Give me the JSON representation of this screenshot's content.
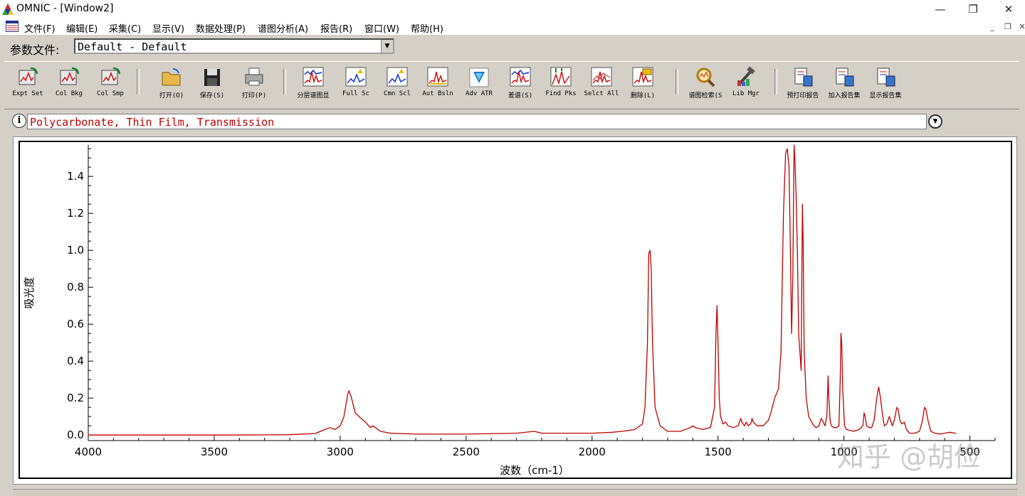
{
  "window": {
    "title": "OMNIC - [Window2]",
    "minimize_glyph": "—",
    "restore_glyph": "❐",
    "close_glyph": "✕"
  },
  "menu": {
    "items": [
      "文件(F)",
      "编辑(E)",
      "采集(C)",
      "显示(V)",
      "数据处理(P)",
      "谱图分析(A)",
      "报告(R)",
      "窗口(W)",
      "帮助(H)"
    ]
  },
  "params": {
    "label": "参数文件:",
    "value": "Default - Default"
  },
  "toolbar": {
    "groups": [
      [
        {
          "label": "Expt Set",
          "icon": "expt-set-icon"
        },
        {
          "label": "Col Bkg",
          "icon": "collect-background-icon"
        },
        {
          "label": "Col Smp",
          "icon": "collect-sample-icon"
        }
      ],
      [
        {
          "label": "打开(O)",
          "icon": "open-folder-icon"
        },
        {
          "label": "保存(S)",
          "icon": "save-disk-icon"
        },
        {
          "label": "打印(P)",
          "icon": "printer-icon"
        }
      ],
      [
        {
          "label": "分层谱图显",
          "icon": "stack-spectra-icon"
        },
        {
          "label": "Full Sc",
          "icon": "full-scale-icon"
        },
        {
          "label": "Cmn Scl",
          "icon": "common-scale-icon"
        },
        {
          "label": "Aut Bsln",
          "icon": "auto-baseline-icon"
        },
        {
          "label": "Adv ATR",
          "icon": "advanced-atr-icon"
        },
        {
          "label": "差谱(S)",
          "icon": "subtract-icon"
        },
        {
          "label": "Find Pks",
          "icon": "find-peaks-icon"
        },
        {
          "label": "Selct All",
          "icon": "select-all-icon"
        },
        {
          "label": "删除(L)",
          "icon": "delete-icon"
        }
      ],
      [
        {
          "label": "谱图检索(S",
          "icon": "search-magnifier-icon"
        },
        {
          "label": "Lib Mgr",
          "icon": "library-manager-icon"
        }
      ],
      [
        {
          "label": "预打印报告",
          "icon": "print-preview-icon"
        },
        {
          "label": "加入报告集",
          "icon": "add-to-report-icon"
        },
        {
          "label": "显示报告集",
          "icon": "show-report-icon"
        }
      ]
    ]
  },
  "spectrum_title": "Polycarbonate, Thin Film, Transmission",
  "watermark": "知乎 @胡俭",
  "colors": {
    "trace": "#c00000",
    "title_text": "#c00000",
    "chrome": "#d4d0c8"
  },
  "chart_data": {
    "type": "line",
    "xlabel": "波数（cm-1）",
    "ylabel": "吸光度",
    "xlim": [
      4000,
      400
    ],
    "ylim": [
      -0.03,
      1.57
    ],
    "x_reversed": true,
    "xticks": [
      4000,
      3500,
      3000,
      2500,
      2000,
      1500,
      1000,
      500
    ],
    "xtick_labels": [
      "4000",
      "3500",
      "3000",
      "2500",
      "2000",
      "1500",
      "1000",
      "500"
    ],
    "yticks": [
      0.0,
      0.2,
      0.4,
      0.6,
      0.8,
      1.0,
      1.2,
      1.4
    ],
    "ytick_labels": [
      "0.0",
      "0.2",
      "0.4",
      "0.6",
      "0.8",
      "1.0",
      "1.2",
      "1.4"
    ],
    "grid": false,
    "series": [
      {
        "color": "#c00000",
        "points": [
          [
            4000,
            0.0
          ],
          [
            3800,
            0.0
          ],
          [
            3600,
            0.0
          ],
          [
            3400,
            0.0
          ],
          [
            3200,
            0.002
          ],
          [
            3100,
            0.008
          ],
          [
            3060,
            0.03
          ],
          [
            3040,
            0.04
          ],
          [
            3020,
            0.03
          ],
          [
            3000,
            0.05
          ],
          [
            2985,
            0.1
          ],
          [
            2970,
            0.22
          ],
          [
            2965,
            0.24
          ],
          [
            2955,
            0.2
          ],
          [
            2940,
            0.12
          ],
          [
            2925,
            0.1
          ],
          [
            2900,
            0.07
          ],
          [
            2880,
            0.04
          ],
          [
            2870,
            0.05
          ],
          [
            2860,
            0.04
          ],
          [
            2840,
            0.02
          ],
          [
            2800,
            0.01
          ],
          [
            2700,
            0.005
          ],
          [
            2500,
            0.005
          ],
          [
            2300,
            0.01
          ],
          [
            2230,
            0.02
          ],
          [
            2200,
            0.01
          ],
          [
            2000,
            0.01
          ],
          [
            1920,
            0.015
          ],
          [
            1880,
            0.02
          ],
          [
            1830,
            0.03
          ],
          [
            1800,
            0.06
          ],
          [
            1790,
            0.15
          ],
          [
            1780,
            0.5
          ],
          [
            1775,
            0.98
          ],
          [
            1770,
            1.0
          ],
          [
            1765,
            0.9
          ],
          [
            1760,
            0.5
          ],
          [
            1750,
            0.15
          ],
          [
            1730,
            0.05
          ],
          [
            1700,
            0.02
          ],
          [
            1650,
            0.02
          ],
          [
            1610,
            0.04
          ],
          [
            1600,
            0.05
          ],
          [
            1590,
            0.04
          ],
          [
            1560,
            0.03
          ],
          [
            1530,
            0.04
          ],
          [
            1514,
            0.15
          ],
          [
            1508,
            0.55
          ],
          [
            1504,
            0.7
          ],
          [
            1500,
            0.5
          ],
          [
            1495,
            0.2
          ],
          [
            1490,
            0.1
          ],
          [
            1480,
            0.06
          ],
          [
            1470,
            0.07
          ],
          [
            1460,
            0.05
          ],
          [
            1440,
            0.04
          ],
          [
            1420,
            0.05
          ],
          [
            1410,
            0.09
          ],
          [
            1405,
            0.07
          ],
          [
            1395,
            0.05
          ],
          [
            1388,
            0.07
          ],
          [
            1380,
            0.05
          ],
          [
            1370,
            0.06
          ],
          [
            1365,
            0.09
          ],
          [
            1360,
            0.07
          ],
          [
            1345,
            0.05
          ],
          [
            1320,
            0.05
          ],
          [
            1300,
            0.08
          ],
          [
            1290,
            0.12
          ],
          [
            1275,
            0.2
          ],
          [
            1260,
            0.25
          ],
          [
            1250,
            0.45
          ],
          [
            1240,
            1.2
          ],
          [
            1232,
            1.52
          ],
          [
            1225,
            1.55
          ],
          [
            1218,
            1.45
          ],
          [
            1212,
            0.95
          ],
          [
            1208,
            0.55
          ],
          [
            1203,
            0.85
          ],
          [
            1198,
            1.57
          ],
          [
            1195,
            1.5
          ],
          [
            1190,
            1.3
          ],
          [
            1185,
            1.0
          ],
          [
            1180,
            0.55
          ],
          [
            1170,
            0.35
          ],
          [
            1165,
            1.25
          ],
          [
            1162,
            1.05
          ],
          [
            1158,
            0.45
          ],
          [
            1150,
            0.2
          ],
          [
            1140,
            0.1
          ],
          [
            1120,
            0.05
          ],
          [
            1110,
            0.04
          ],
          [
            1100,
            0.05
          ],
          [
            1090,
            0.09
          ],
          [
            1082,
            0.07
          ],
          [
            1075,
            0.05
          ],
          [
            1068,
            0.1
          ],
          [
            1063,
            0.32
          ],
          [
            1060,
            0.2
          ],
          [
            1055,
            0.08
          ],
          [
            1050,
            0.05
          ],
          [
            1040,
            0.04
          ],
          [
            1030,
            0.04
          ],
          [
            1020,
            0.05
          ],
          [
            1015,
            0.3
          ],
          [
            1012,
            0.55
          ],
          [
            1009,
            0.5
          ],
          [
            1005,
            0.25
          ],
          [
            998,
            0.05
          ],
          [
            990,
            0.03
          ],
          [
            960,
            0.02
          ],
          [
            940,
            0.03
          ],
          [
            925,
            0.05
          ],
          [
            920,
            0.12
          ],
          [
            916,
            0.1
          ],
          [
            910,
            0.05
          ],
          [
            900,
            0.04
          ],
          [
            890,
            0.04
          ],
          [
            880,
            0.08
          ],
          [
            870,
            0.2
          ],
          [
            862,
            0.26
          ],
          [
            855,
            0.2
          ],
          [
            848,
            0.12
          ],
          [
            840,
            0.05
          ],
          [
            830,
            0.06
          ],
          [
            820,
            0.1
          ],
          [
            815,
            0.08
          ],
          [
            808,
            0.05
          ],
          [
            800,
            0.08
          ],
          [
            790,
            0.15
          ],
          [
            785,
            0.14
          ],
          [
            778,
            0.08
          ],
          [
            770,
            0.06
          ],
          [
            760,
            0.07
          ],
          [
            752,
            0.03
          ],
          [
            740,
            0.01
          ],
          [
            720,
            0.01
          ],
          [
            700,
            0.02
          ],
          [
            690,
            0.07
          ],
          [
            680,
            0.15
          ],
          [
            675,
            0.14
          ],
          [
            665,
            0.07
          ],
          [
            655,
            0.02
          ],
          [
            640,
            0.01
          ],
          [
            620,
            0.005
          ],
          [
            600,
            0.01
          ],
          [
            580,
            0.015
          ],
          [
            560,
            0.01
          ],
          [
            555,
            0.01
          ]
        ]
      }
    ]
  }
}
